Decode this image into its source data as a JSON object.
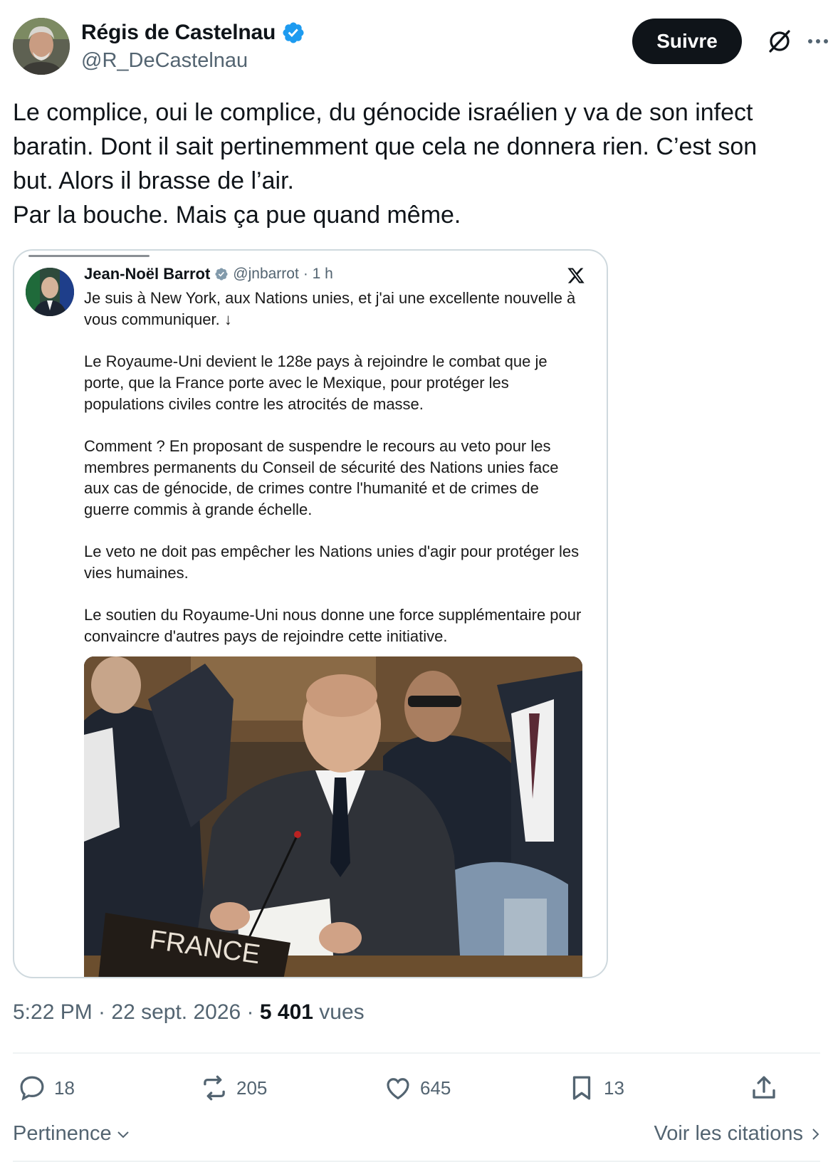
{
  "author": {
    "name": "Régis de Castelnau",
    "handle": "@R_DeCastelnau",
    "verified": true
  },
  "header": {
    "follow_label": "Suivre",
    "icons": [
      "grok-icon",
      "more-icon"
    ]
  },
  "tweet": {
    "lines": [
      "Le complice, oui le complice, du génocide israélien y va de son infect",
      "baratin. Dont il sait pertinemment que cela ne donnera rien. C’est son",
      "but. Alors il brasse de l’air.",
      "Par la bouche. Mais ça pue quand même."
    ]
  },
  "quote": {
    "name": "Jean-Noël Barrot",
    "handle": "@jnbarrot",
    "time": "· 1 h",
    "source_icon": "x-logo-icon",
    "paragraphs": [
      [
        "Je suis à New York, aux Nations unies, et j'ai une excellente nouvelle à",
        "vous communiquer. ↓"
      ],
      [
        "Le Royaume-Uni devient le 128e pays à rejoindre le combat que je",
        "porte, que la France porte avec le Mexique, pour protéger les",
        "populations civiles contre les atrocités de masse."
      ],
      [
        "Comment ? En proposant de suspendre le recours au veto pour les",
        "membres permanents du Conseil de sécurité des Nations unies face",
        "aux cas de génocide, de crimes contre l'humanité et de crimes de",
        "guerre commis à grande échelle."
      ],
      [
        "Le veto ne doit pas empêcher les Nations unies d'agir pour protéger les",
        "vies humaines."
      ],
      [
        "Le soutien du Royaume-Uni nous donne une force supplémentaire pour",
        "convaincre d'autres pays de rejoindre cette initiative."
      ]
    ],
    "photo_nameplate": "FRANCE"
  },
  "meta": {
    "time": "5:22 PM · 22 sept. 2026 · ",
    "views_count": "5 401",
    "views_label": " vues"
  },
  "actions": {
    "replies": "18",
    "reposts": "205",
    "likes": "645",
    "bookmarks": "13"
  },
  "footer": {
    "sort_label": "Pertinence",
    "quotes_label": "Voir les citations"
  },
  "colors": {
    "text": "#0f1419",
    "secondary": "#536471",
    "verified": "#1d9bf0",
    "border": "#cfd9de"
  }
}
